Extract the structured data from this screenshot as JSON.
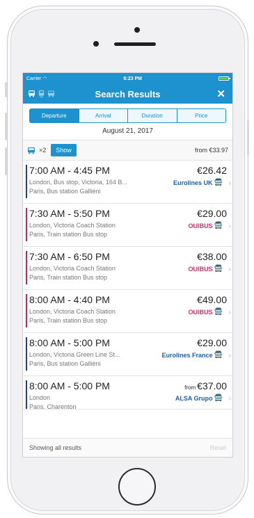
{
  "status_bar": {
    "carrier": "Carrier",
    "time": "6:23 PM"
  },
  "header": {
    "title": "Search Results",
    "close_label": "✕",
    "mode_icons": [
      "bus-icon",
      "train-icon",
      "coach-icon"
    ]
  },
  "sort_tabs": [
    "Departure",
    "Arrival",
    "Duration",
    "Price"
  ],
  "date": "August 21, 2017",
  "filter": {
    "passengers": "×2",
    "show_label": "Show",
    "from_price": "from €33.97"
  },
  "results": [
    {
      "time": "7:00 AM - 4:45 PM",
      "price": "€26.42",
      "price_prefix": "",
      "origin": "London, Bus stop, Victoria, 164 B...",
      "destination": "Paris, Bus station Galliéni",
      "carrier": "Eurolines UK",
      "carrier_color": "#1f5fa8",
      "accent": "#1f3f8c"
    },
    {
      "time": "7:30 AM - 5:50 PM",
      "price": "€29.00",
      "price_prefix": "",
      "origin": "London, Victoria Coach Station",
      "destination": "Paris, Train station Bus stop",
      "carrier": "OUIBUS",
      "carrier_color": "#d1336b",
      "accent": "#c8245c"
    },
    {
      "time": "7:30 AM - 6:50 PM",
      "price": "€38.00",
      "price_prefix": "",
      "origin": "London, Victoria Coach Station",
      "destination": "Paris, Train station Bus stop",
      "carrier": "OUIBUS",
      "carrier_color": "#d1336b",
      "accent": "#c8245c"
    },
    {
      "time": "8:00 AM - 4:40 PM",
      "price": "€49.00",
      "price_prefix": "",
      "origin": "London, Victoria Coach Station",
      "destination": "Paris, Train station Bus stop",
      "carrier": "OUIBUS",
      "carrier_color": "#d1336b",
      "accent": "#c8245c"
    },
    {
      "time": "8:00 AM - 5:00 PM",
      "price": "€29.00",
      "price_prefix": "",
      "origin": "London, Victoria Green Line St...",
      "destination": "Paris, Bus station Galliéni",
      "carrier": "Eurolines France",
      "carrier_color": "#1f5fa8",
      "accent": "#1f3f8c"
    },
    {
      "time": "8:00 AM - 5:00 PM",
      "price": "€37.00",
      "price_prefix": "from",
      "origin": "London",
      "destination": "Paris, Charenton",
      "carrier": "ALSA Grupo",
      "carrier_color": "#1f5fa8",
      "accent": "#1f3f8c"
    }
  ],
  "footer": {
    "status": "Showing all results",
    "reset_label": "Reset"
  }
}
